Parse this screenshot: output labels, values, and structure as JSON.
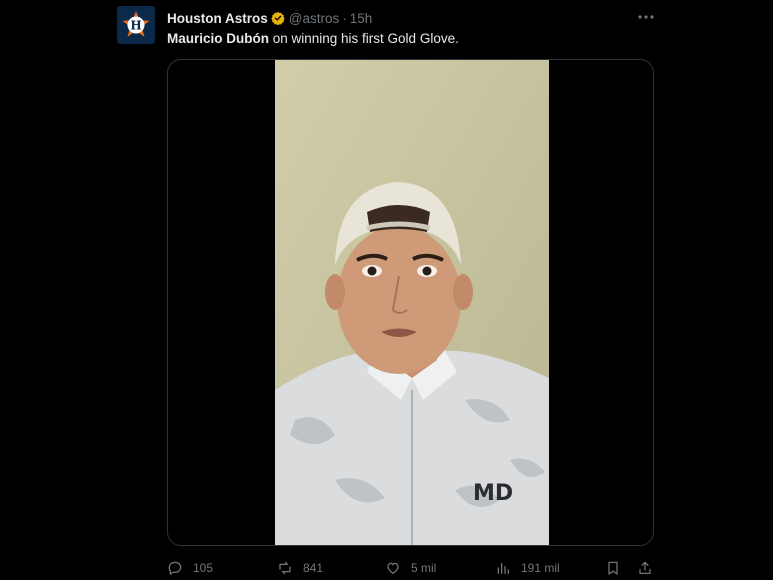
{
  "tweet": {
    "author_name": "Houston Astros",
    "handle": "@astros",
    "separator": "·",
    "time": "15h",
    "text_mention": "Mauricio Dubón",
    "text_rest": " on winning his first Gold Glove.",
    "media_overlay_text": "MD"
  },
  "actions": {
    "replies": "105",
    "reposts": "841",
    "likes": "5 mil",
    "views": "191 mil"
  },
  "colors": {
    "background": "#000000",
    "text_primary": "#e7e9ea",
    "text_secondary": "#71767b",
    "verified_badge": "#e8b10c",
    "astros_navy": "#0b2a4a",
    "astros_orange": "#eb6e1f"
  },
  "icons": {
    "avatar": "astros-logo-icon",
    "verified": "verified-badge-icon",
    "more": "more-options-icon",
    "reply": "reply-icon",
    "repost": "repost-icon",
    "like": "like-icon",
    "views": "views-icon",
    "bookmark": "bookmark-icon",
    "share": "share-icon"
  }
}
